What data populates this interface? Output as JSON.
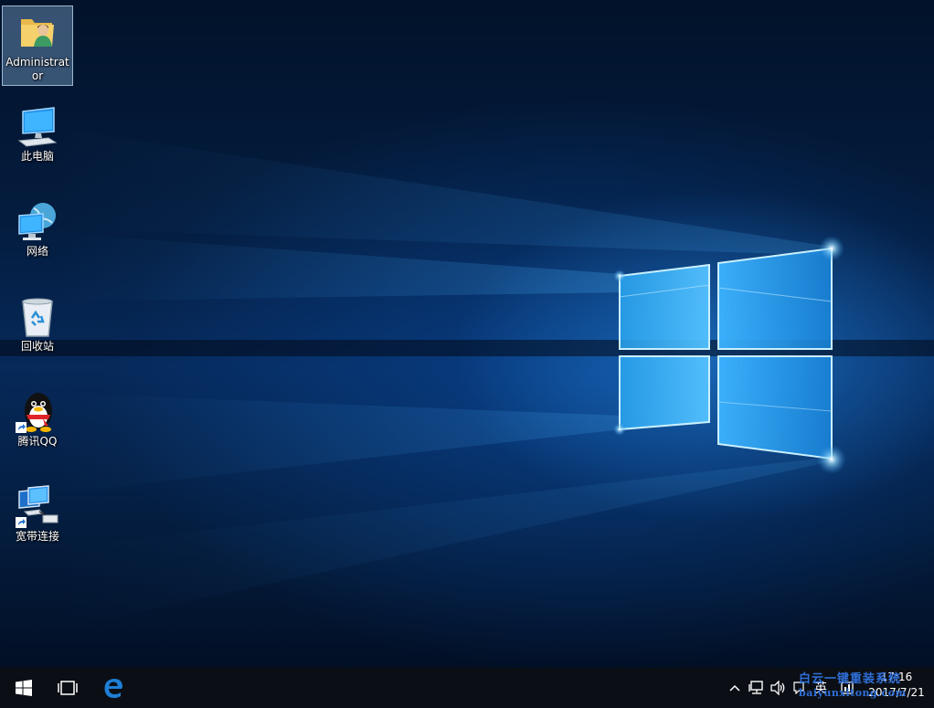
{
  "desktop": {
    "icons": [
      {
        "label": "Administrator",
        "icon": "user-folder-icon",
        "selected": true
      },
      {
        "label": "此电脑",
        "icon": "computer-icon"
      },
      {
        "label": "网络",
        "icon": "network-globe-icon"
      },
      {
        "label": "回收站",
        "icon": "recycle-bin-icon"
      },
      {
        "label": "腾讯QQ",
        "icon": "qq-penguin-icon",
        "shortcut": true
      },
      {
        "label": "宽带连接",
        "icon": "broadband-connection-icon",
        "shortcut": true
      }
    ]
  },
  "taskbar": {
    "start": "windows-logo-icon",
    "task_view": "task-view-icon",
    "edge": "edge-browser-icon",
    "tray": {
      "chevron": "chevron-up-icon",
      "network": "network-icon",
      "volume": "volume-icon",
      "ime": "英",
      "notification": "action-center-icon"
    },
    "time": "17:16",
    "date": "2017/7/21"
  },
  "watermark": {
    "title": "白云一键重装系统",
    "url": "baiyunxitong.com"
  },
  "colors": {
    "taskbar": "#0b0f15",
    "edge_blue": "#1e7fd6",
    "window_glow": "#7fd4ff"
  }
}
